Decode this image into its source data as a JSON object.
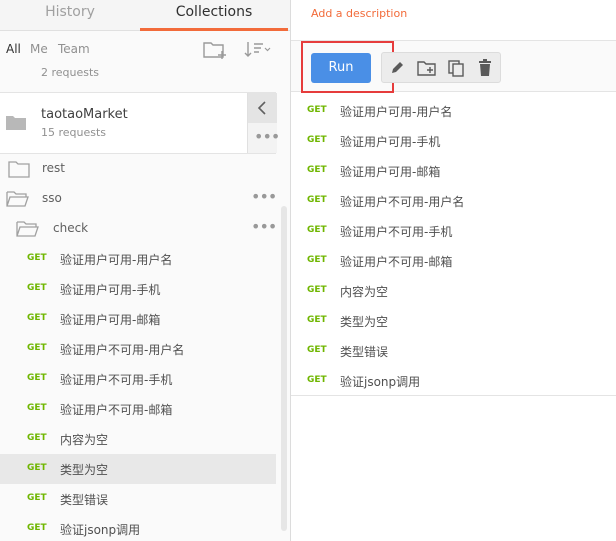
{
  "tabs": {
    "history": "History",
    "collections": "Collections"
  },
  "filters": {
    "all": "All",
    "me": "Me",
    "team": "Team"
  },
  "prev_collection": {
    "count": "2 requests"
  },
  "collection": {
    "name": "taotaoMarket",
    "count": "15 requests"
  },
  "folders": {
    "rest": "rest",
    "sso": "sso",
    "check": "check"
  },
  "dots": "•••",
  "method": "GET",
  "left_requests": [
    "验证用户可用-用户名",
    "验证用户可用-手机",
    "验证用户可用-邮箱",
    "验证用户不可用-用户名",
    "验证用户不可用-手机",
    "验证用户不可用-邮箱",
    "内容为空",
    "类型为空",
    "类型错误",
    "验证jsonp调用"
  ],
  "right": {
    "description": "Add a description",
    "run_label": "Run",
    "requests": [
      "验证用户可用-用户名",
      "验证用户可用-手机",
      "验证用户可用-邮箱",
      "验证用户不可用-用户名",
      "验证用户不可用-手机",
      "验证用户不可用-邮箱",
      "内容为空",
      "类型为空",
      "类型错误",
      "验证jsonp调用"
    ]
  },
  "colors": {
    "accent": "#f26b3a",
    "run": "#4a8fe6",
    "get": "#6fb600",
    "highlight": "#e63c3c"
  }
}
